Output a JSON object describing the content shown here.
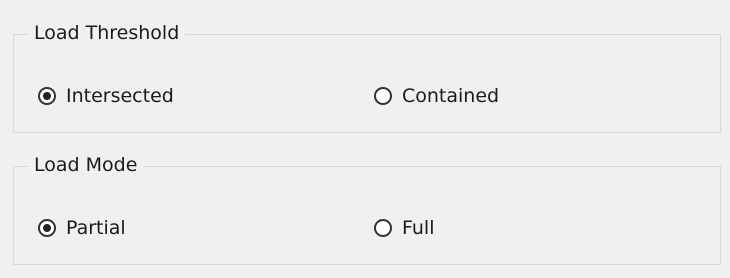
{
  "load_threshold": {
    "title": "Load Threshold",
    "options": [
      {
        "label": "Intersected",
        "checked": true
      },
      {
        "label": "Contained",
        "checked": false
      }
    ]
  },
  "load_mode": {
    "title": "Load Mode",
    "options": [
      {
        "label": "Partial",
        "checked": true
      },
      {
        "label": "Full",
        "checked": false
      }
    ]
  }
}
